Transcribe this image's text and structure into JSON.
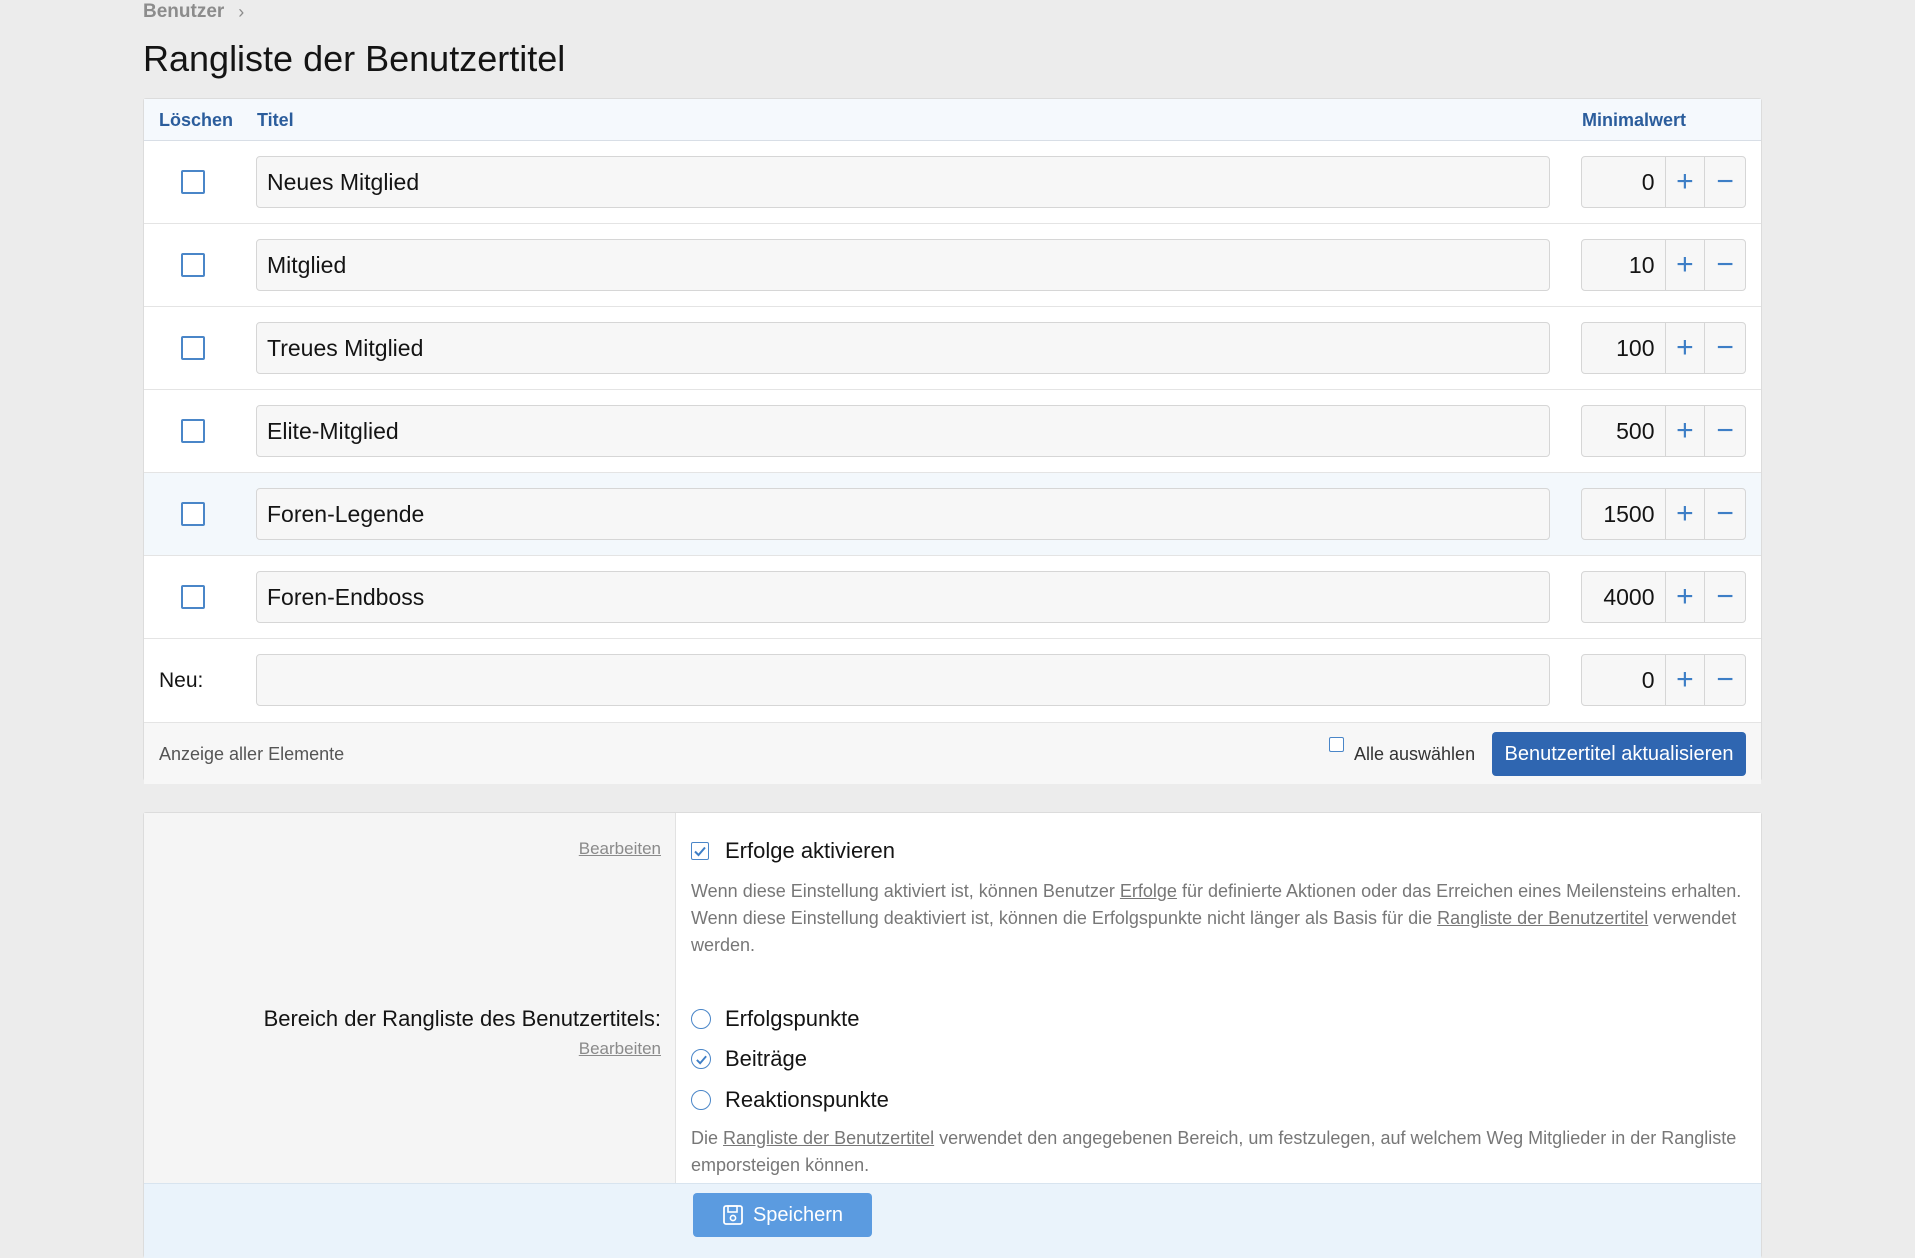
{
  "breadcrumb": {
    "item": "Benutzer",
    "separator": "›"
  },
  "page": {
    "title": "Rangliste der Benutzertitel"
  },
  "table": {
    "headers": {
      "delete": "Löschen",
      "title": "Titel",
      "min_value": "Minimalwert"
    },
    "rows": [
      {
        "title": "Neues Mitglied",
        "min": "0"
      },
      {
        "title": "Mitglied",
        "min": "10"
      },
      {
        "title": "Treues Mitglied",
        "min": "100"
      },
      {
        "title": "Elite-Mitglied",
        "min": "500"
      },
      {
        "title": "Foren-Legende",
        "min": "1500"
      },
      {
        "title": "Foren-Endboss",
        "min": "4000"
      }
    ],
    "new_row": {
      "label": "Neu:",
      "title": "",
      "min": "0"
    },
    "stepper": {
      "plus": "+",
      "minus": "−"
    },
    "footer": {
      "display_all": "Anzeige aller Elemente",
      "select_all": "Alle auswählen",
      "update_button": "Benutzertitel aktualisieren"
    }
  },
  "options": {
    "edit_label": "Bearbeiten",
    "achievements": {
      "title": "Erfolge aktivieren",
      "checked": true,
      "desc_part1": "Wenn diese Einstellung aktiviert ist, können Benutzer ",
      "desc_link1": "Erfolge",
      "desc_part2": " für definierte Aktionen oder das Erreichen eines Meilensteins erhalten. Wenn diese Einstellung deaktiviert ist, können die Erfolgspunkte nicht länger als Basis für die ",
      "desc_link2": "Rangliste der Benutzertitel",
      "desc_part3": " verwendet werden."
    },
    "ladder_field": {
      "label": "Bereich der Rangliste des Benutzertitels:",
      "choices": [
        "Erfolgspunkte",
        "Beiträge",
        "Reaktionspunkte"
      ],
      "selected": "Beiträge",
      "desc_part1": "Die ",
      "desc_link": "Rangliste der Benutzertitel",
      "desc_part2": " verwendet den angegebenen Bereich, um festzulegen, auf welchem Weg Mitglieder in der Rangliste emporsteigen können."
    },
    "save_button": "Speichern"
  },
  "colors": {
    "accent": "#2f66b1",
    "link_blue": "#3d7ec6",
    "save": "#5b9be0"
  },
  "icons": {
    "save": "save-icon",
    "check": "check-icon"
  }
}
